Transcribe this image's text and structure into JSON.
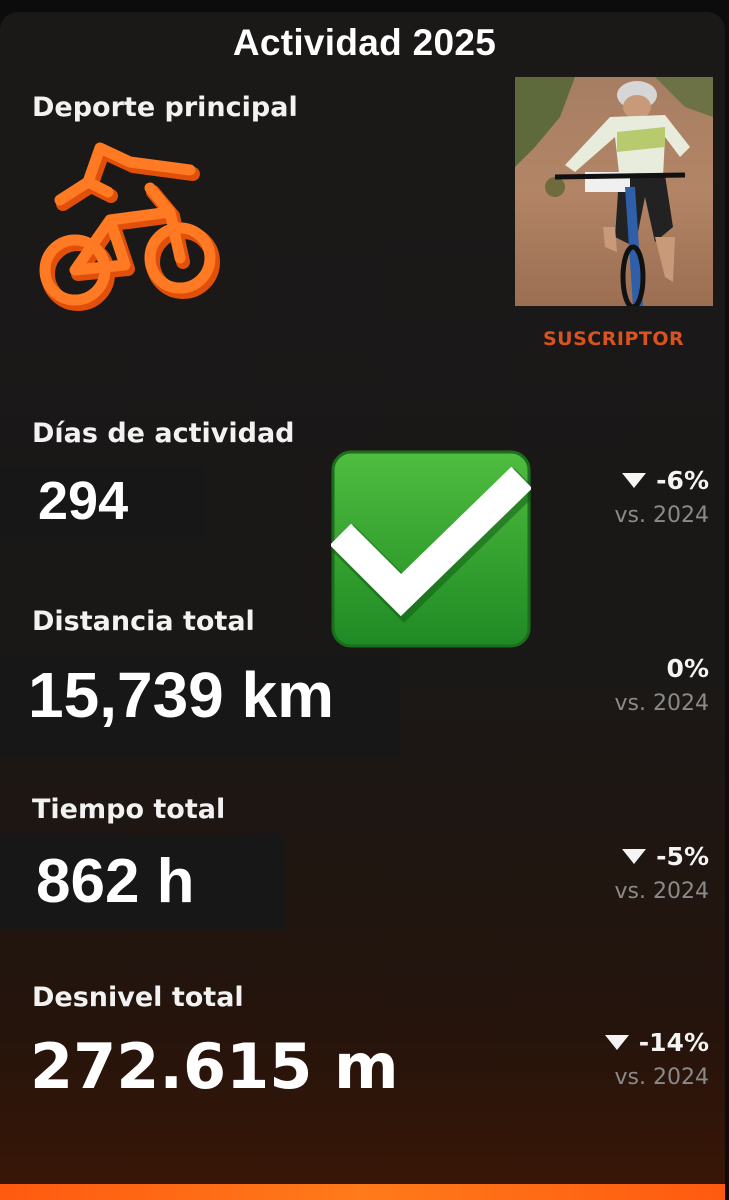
{
  "title": "Actividad 2025",
  "main_sport": {
    "label": "Deporte principal",
    "icon": "bike-icon",
    "icon_color": "#ff6a14"
  },
  "photo": {
    "caption": "SUSCRIPTOR",
    "caption_color": "#d9531e"
  },
  "checkmark": {
    "icon": "check-icon",
    "color": "#2e9e2e"
  },
  "stats": [
    {
      "label": "Días de actividad",
      "value": "294",
      "change": "-6%",
      "direction": "down",
      "comparison": "vs. 2024"
    },
    {
      "label": "Distancia total",
      "value": "15,739 km",
      "change": "0%",
      "direction": "none",
      "comparison": "vs. 2024"
    },
    {
      "label": "Tiempo total",
      "value": "862 h",
      "change": "-5%",
      "direction": "down",
      "comparison": "vs. 2024"
    },
    {
      "label": "Desnivel total",
      "value": "272.615 m",
      "change": "-14%",
      "direction": "down",
      "comparison": "vs. 2024"
    }
  ],
  "accent_color": "#ff5a10"
}
